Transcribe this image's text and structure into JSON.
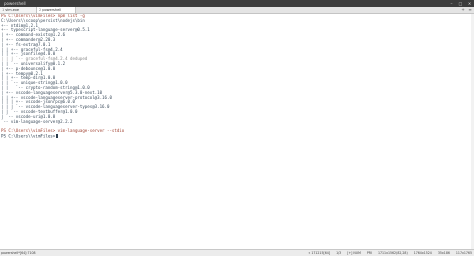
{
  "window": {
    "title": "powershell",
    "controls": {
      "minimize": "–",
      "maximize": "□",
      "close": "✕"
    }
  },
  "tabs": [
    {
      "num": "1",
      "label": "vim.exe",
      "active": false
    },
    {
      "num": "2",
      "label": "powershell",
      "active": true
    }
  ],
  "toolbar_icons": [
    "new-tab-icon",
    "menu-icon"
  ],
  "console_lines": [
    {
      "text": "PS C:\\Users\\\\vimFiles> npm list -g",
      "style": "cmd"
    },
    {
      "text": "C:\\Users\\\\scoop\\persist\\nodejs\\bin",
      "style": ""
    },
    {
      "text": "+-- ntdim@1.2.1",
      "style": ""
    },
    {
      "text": "+-- typescript-language-server@0.5.1",
      "style": ""
    },
    {
      "text": "| +-- command-exists@1.2.6",
      "style": ""
    },
    {
      "text": "| +-- commander@2.20.3",
      "style": ""
    },
    {
      "text": "| +-- fs-extra@7.0.1",
      "style": ""
    },
    {
      "text": "| | +-- graceful-fs@4.2.4",
      "style": ""
    },
    {
      "text": "| | +-- jsonfile@4.0.0",
      "style": ""
    },
    {
      "text": "| | | `-- graceful-fs@4.2.4 deduped",
      "style": "dim"
    },
    {
      "text": "| | `-- universalify@0.1.2",
      "style": ""
    },
    {
      "text": "| +-- p-debounce@1.0.0",
      "style": ""
    },
    {
      "text": "| +-- tempy@0.2.1",
      "style": ""
    },
    {
      "text": "| | +-- temp-dir@1.0.0",
      "style": ""
    },
    {
      "text": "| | `-- unique-string@1.0.0",
      "style": ""
    },
    {
      "text": "| |   `-- crypto-random-string@1.0.0",
      "style": ""
    },
    {
      "text": "| +-- vscode-languageserver@5.3.0-next.10",
      "style": ""
    },
    {
      "text": "| | +-- vscode-languageserver-protocol@3.16.0",
      "style": ""
    },
    {
      "text": "| | | +-- vscode-jsonrpc@6.0.0",
      "style": ""
    },
    {
      "text": "| | | `-- vscode-languageserver-types@3.16.0",
      "style": ""
    },
    {
      "text": "| | `-- vscode-textbuffer@1.0.0",
      "style": ""
    },
    {
      "text": "| `-- vscode-uri@1.0.8",
      "style": ""
    },
    {
      "text": "`-- vim-language-server@2.2.2",
      "style": ""
    },
    {
      "text": "",
      "style": ""
    },
    {
      "text": "PS C:\\Users\\\\vimFiles> vim-language-server --stdio",
      "style": "cmd"
    },
    {
      "text": "PS C:\\Users\\\\vimFiles>",
      "style": "prompt",
      "cursor": true
    }
  ],
  "status_bar": {
    "left": "powershell*[64]:7108",
    "right": [
      "« 171215[64]",
      "1/3",
      "[+] NUM",
      "PRI",
      "1711x1562(82,28)",
      "1764x1524",
      "35x186",
      "117x1765"
    ]
  },
  "colors": {
    "background": "#ffffff",
    "text": "#3a4a5a",
    "command": "#a04030",
    "titlebar": "#3c3c3c"
  }
}
